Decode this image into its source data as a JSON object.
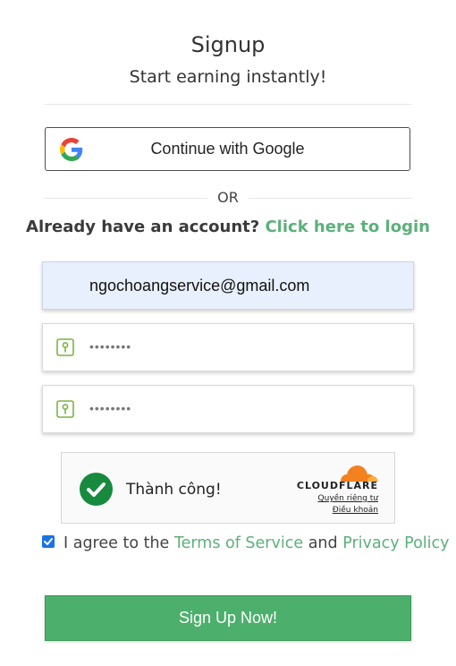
{
  "header": {
    "title": "Signup",
    "subtitle": "Start earning instantly!"
  },
  "google": {
    "label": "Continue with Google",
    "icon": "google-g-icon"
  },
  "divider": {
    "or": "OR"
  },
  "login": {
    "prompt": "Already have an account?",
    "link": "Click here to login"
  },
  "form": {
    "email_value": "ngochoangservice@gmail.com",
    "password_mask": "••••••••",
    "confirm_mask": "••••••••"
  },
  "captcha": {
    "status": "Thành công!",
    "brand": "CLOUDFLARE",
    "privacy": "Quyền riêng tư",
    "terms": "Điều khoản"
  },
  "agree": {
    "prefix": "I agree to the",
    "terms_link": "Terms of Service",
    "and": "and",
    "privacy_link": "Privacy Policy",
    "checked": true
  },
  "submit": {
    "label": "Sign Up Now!"
  },
  "colors": {
    "accent_green": "#5cb07a",
    "button_green": "#4caf6c",
    "success_green": "#178a3e",
    "cloudflare_orange": "#f48120"
  }
}
